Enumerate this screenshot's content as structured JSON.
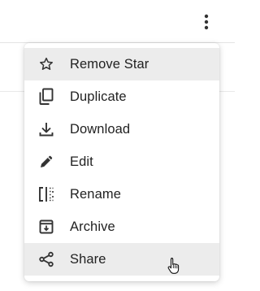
{
  "menu": {
    "items": [
      {
        "label": "Remove Star",
        "icon": "star-outline-icon",
        "highlighted": true
      },
      {
        "label": "Duplicate",
        "icon": "copy-icon",
        "highlighted": false
      },
      {
        "label": "Download",
        "icon": "download-icon",
        "highlighted": false
      },
      {
        "label": "Edit",
        "icon": "pencil-icon",
        "highlighted": false
      },
      {
        "label": "Rename",
        "icon": "rename-icon",
        "highlighted": false
      },
      {
        "label": "Archive",
        "icon": "archive-icon",
        "highlighted": false
      },
      {
        "label": "Share",
        "icon": "share-icon",
        "highlighted": true
      }
    ]
  },
  "colors": {
    "text": "#222222",
    "highlight": "#ececec",
    "icon": "#333333"
  }
}
